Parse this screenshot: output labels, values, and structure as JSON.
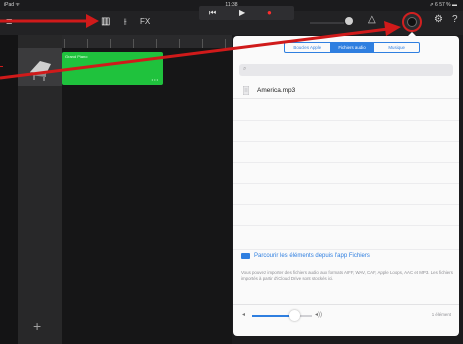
{
  "status_bar": {
    "device": "iPad ᯤ",
    "time": "11:38",
    "battery": "⇗ 6 57 % ▬"
  },
  "toolbar": {
    "menu_glyph": "≡",
    "keys_glyph": "▥",
    "mixer_glyph": "⫲",
    "fx_label": "FX",
    "rewind_glyph": "⏮",
    "play_glyph": "▶",
    "record_glyph": "●",
    "metronome_glyph": "△",
    "settings_glyph": "⚙",
    "help_glyph": "?"
  },
  "tracks": {
    "region_label": "Grand Piano",
    "region_dots": "• • •",
    "add_label": "+"
  },
  "panel": {
    "segments": [
      {
        "label": "Boucles Apple",
        "active": false
      },
      {
        "label": "Fichiers audio",
        "active": true
      },
      {
        "label": "Musique",
        "active": false
      }
    ],
    "search_icon_glyph": "⌕",
    "file": {
      "name": "America.mp3"
    },
    "browse_link": "Parcourir les éléments depuis l'app Fichiers",
    "info_text": "Vous pouvez importer des fichiers audio aux formats AIFF, WAV, CAF, Apple Loops, AAC et MP3. Les fichiers importés à partir d'iCloud Drive sont stockés ici.",
    "volume_low": "◂",
    "volume_high": "◂))",
    "count": "1 élément",
    "slider_value": 0.7
  },
  "annotations": {
    "arrow_color": "#d01a1a"
  }
}
